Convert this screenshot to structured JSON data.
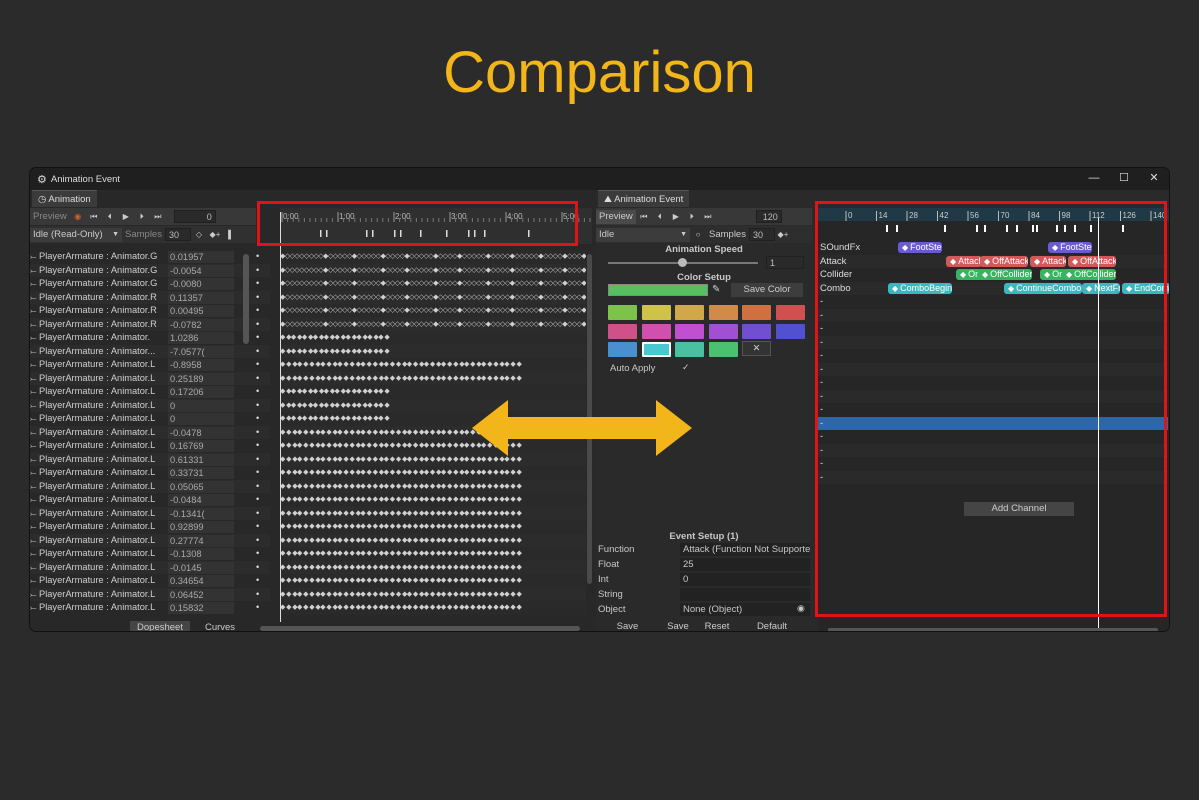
{
  "slide": {
    "title": "Comparison",
    "title_color": "#f2b51a"
  },
  "window": {
    "title": "Animation Event",
    "minimize": "—",
    "maximize": "☐",
    "close": "✕"
  },
  "anim_panel": {
    "tab_label": "Animation",
    "preview_label": "Preview",
    "frame_value": "0",
    "clip_select": "Idle (Read-Only)",
    "samples_label": "Samples",
    "samples_value": "30",
    "time_labels": [
      "0:00",
      "1:00",
      "2:00",
      "3:00",
      "4:00",
      "5:00"
    ],
    "properties": [
      {
        "name": "PlayerArmature : Animator.G",
        "value": "0.01957"
      },
      {
        "name": "PlayerArmature : Animator.G",
        "value": "-0.0054"
      },
      {
        "name": "PlayerArmature : Animator.G",
        "value": "-0.0080"
      },
      {
        "name": "PlayerArmature : Animator.R",
        "value": "0.11357"
      },
      {
        "name": "PlayerArmature : Animator.R",
        "value": "0.00495"
      },
      {
        "name": "PlayerArmature : Animator.R",
        "value": "-0.0782"
      },
      {
        "name": "PlayerArmature : Animator.",
        "value": "1.0286"
      },
      {
        "name": "PlayerArmature : Animator...",
        "value": "-7.0577("
      },
      {
        "name": "PlayerArmature : Animator.L",
        "value": "-0.8958"
      },
      {
        "name": "PlayerArmature : Animator.L",
        "value": "0.25189"
      },
      {
        "name": "PlayerArmature : Animator.L",
        "value": "0.17206"
      },
      {
        "name": "PlayerArmature : Animator.L",
        "value": "0"
      },
      {
        "name": "PlayerArmature : Animator.L",
        "value": "0"
      },
      {
        "name": "PlayerArmature : Animator.L",
        "value": "-0.0478"
      },
      {
        "name": "PlayerArmature : Animator.L",
        "value": "0.16769"
      },
      {
        "name": "PlayerArmature : Animator.L",
        "value": "0.61331"
      },
      {
        "name": "PlayerArmature : Animator.L",
        "value": "0.33731"
      },
      {
        "name": "PlayerArmature : Animator.L",
        "value": "0.05065"
      },
      {
        "name": "PlayerArmature : Animator.L",
        "value": "-0.0484"
      },
      {
        "name": "PlayerArmature : Animator.L",
        "value": "-0.1341("
      },
      {
        "name": "PlayerArmature : Animator.L",
        "value": "0.92899"
      },
      {
        "name": "PlayerArmature : Animator.L",
        "value": "0.27774"
      },
      {
        "name": "PlayerArmature : Animator.L",
        "value": "-0.1308"
      },
      {
        "name": "PlayerArmature : Animator.L",
        "value": "-0.0145"
      },
      {
        "name": "PlayerArmature : Animator.L",
        "value": "0.34654"
      },
      {
        "name": "PlayerArmature : Animator.L",
        "value": "0.06452"
      },
      {
        "name": "PlayerArmature : Animator.L",
        "value": "0.15832"
      }
    ],
    "dopesheet_label": "Dopesheet",
    "curves_label": "Curves"
  },
  "event_panel": {
    "tab_label": "Animation Event",
    "preview_label": "Preview",
    "frame_value": "120",
    "clip_select": "Idle",
    "samples_label": "Samples",
    "samples_value": "30",
    "speed_heading": "Animation Speed",
    "speed_value": "1",
    "color_heading": "Color Setup",
    "save_color_label": "Save Color",
    "selected_color": "#55c060",
    "swatches": [
      "#7dc24a",
      "#cfc24a",
      "#d0a84a",
      "#d08a4a",
      "#d07040",
      "#d05050",
      "#d0508a",
      "#d050b0",
      "#c050d0",
      "#a050d0",
      "#7050d0",
      "#5050d0",
      "#4a90d0",
      "#4ac8d0",
      "#4ac0a0",
      "#4ac070"
    ],
    "auto_apply_label": "Auto Apply",
    "auto_apply_check": "✓",
    "event_setup_heading": "Event Setup (1)",
    "fields": [
      {
        "label": "Function",
        "value": "Attack (Function Not Supporte"
      },
      {
        "label": "Float",
        "value": "25"
      },
      {
        "label": "Int",
        "value": "0"
      },
      {
        "label": "String",
        "value": ""
      },
      {
        "label": "Object",
        "value": "None (Object)"
      }
    ],
    "footer_buttons": [
      "Save current*",
      "Save all",
      "Reset",
      "Default"
    ],
    "ruler_labels": [
      "0",
      "14",
      "28",
      "42",
      "56",
      "70",
      "84",
      "98",
      "112",
      "126",
      "140"
    ],
    "channels": [
      "SOundFx",
      "Attack",
      "Collider",
      "Combo"
    ],
    "events": [
      {
        "channel": 0,
        "label": "FootStep",
        "color": "#6a5cd0"
      },
      {
        "channel": 0,
        "label": "FootStep",
        "color": "#6a5cd0"
      },
      {
        "channel": 1,
        "label": "Attack",
        "color": "#d05a5a"
      },
      {
        "channel": 1,
        "label": "OffAttack",
        "color": "#d05a5a"
      },
      {
        "channel": 1,
        "label": "Attack",
        "color": "#d05a5a"
      },
      {
        "channel": 1,
        "label": "OffAttack",
        "color": "#d05a5a"
      },
      {
        "channel": 2,
        "label": "On",
        "color": "#35b560"
      },
      {
        "channel": 2,
        "label": "OffCollider",
        "color": "#35b560"
      },
      {
        "channel": 2,
        "label": "On",
        "color": "#35b560"
      },
      {
        "channel": 2,
        "label": "OffCollider",
        "color": "#35b560"
      },
      {
        "channel": 3,
        "label": "ComboBegin",
        "color": "#3ab8c0"
      },
      {
        "channel": 3,
        "label": "ContinueCombo",
        "color": "#3ab8c0"
      },
      {
        "channel": 3,
        "label": "NextFrame",
        "color": "#3ab8c0"
      },
      {
        "channel": 3,
        "label": "EndCombo",
        "color": "#3ab8c0"
      }
    ],
    "add_channel_label": "Add Channel",
    "dash": "-"
  },
  "colors": {
    "highlight_red": "#e01414",
    "arrow": "#f2b51a",
    "selection_row": "#2f66a8"
  }
}
